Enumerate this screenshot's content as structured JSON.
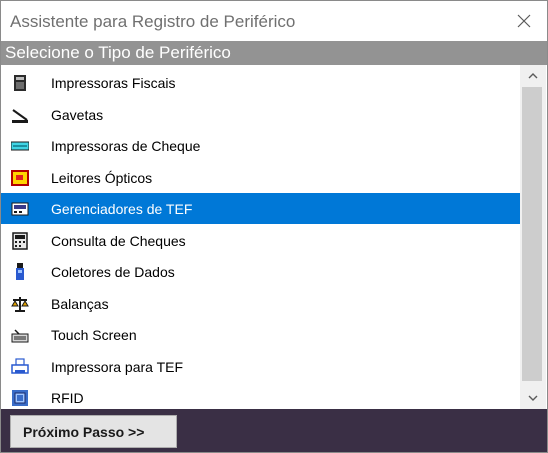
{
  "window": {
    "title": "Assistente para Registro de Periférico"
  },
  "header": {
    "label": "Selecione o Tipo de Periférico"
  },
  "list": {
    "selected_index": 4,
    "items": [
      {
        "label": "Impressoras Fiscais",
        "icon": "fiscal-printer-icon"
      },
      {
        "label": "Gavetas",
        "icon": "drawer-icon"
      },
      {
        "label": "Impressoras de Cheque",
        "icon": "check-printer-icon"
      },
      {
        "label": "Leitores Ópticos",
        "icon": "optical-reader-icon"
      },
      {
        "label": "Gerenciadores de TEF",
        "icon": "tef-manager-icon"
      },
      {
        "label": "Consulta de Cheques",
        "icon": "check-query-icon"
      },
      {
        "label": "Coletores de Dados",
        "icon": "data-collector-icon"
      },
      {
        "label": "Balanças",
        "icon": "scale-icon"
      },
      {
        "label": "Touch Screen",
        "icon": "touch-screen-icon"
      },
      {
        "label": "Impressora para TEF",
        "icon": "tef-printer-icon"
      },
      {
        "label": "RFID",
        "icon": "rfid-icon"
      }
    ]
  },
  "footer": {
    "next_label": "Próximo Passo >>"
  },
  "colors": {
    "selection": "#0078d7",
    "header_band": "#939393",
    "footer": "#3a2f45"
  }
}
